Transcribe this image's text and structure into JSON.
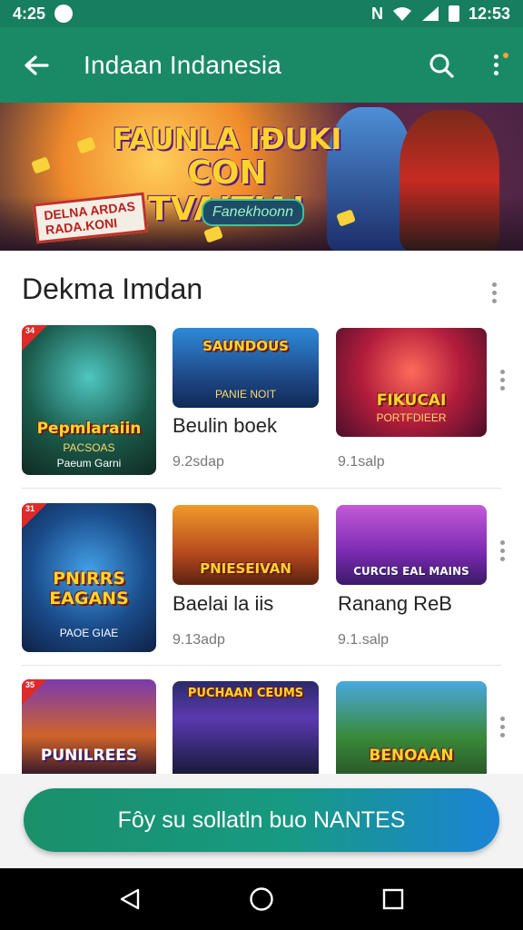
{
  "status_bar": {
    "time": "4:25",
    "right_text": "N",
    "clock": "12:53"
  },
  "app_bar": {
    "title": "Indaan Indanesia"
  },
  "banner": {
    "headline_line1": "FAUNLA IÐUKI",
    "headline_line2": "CON TVAITIA!",
    "sticker_line1": "DELNA ARDAS",
    "sticker_line2": "RADA.KONI",
    "tag": "Fanekhoonn"
  },
  "section": {
    "title": "Dekma Imdan",
    "rows": [
      {
        "featured": {
          "art_title": "Pepmlaraiin",
          "art_sub1": "PACSOAS",
          "art_sub2": "Paeum Garni",
          "corner": "34"
        },
        "items": [
          {
            "art_title": "SAUNDOUS",
            "art_sub": "PANIE NOIT",
            "name": "Beulin boek",
            "size": "9.2sdap"
          },
          {
            "art_title": "FIKUCAI",
            "art_sub": "PORTFDIEER",
            "name": "",
            "size": "9.1salp"
          }
        ]
      },
      {
        "featured": {
          "art_title": "PNIRRS EAGANS",
          "art_sub1": "PAOE GIAE",
          "art_sub2": "",
          "corner": "31"
        },
        "items": [
          {
            "art_title": "PNIESEIVAN",
            "art_sub": "",
            "name": "Baelai la iis",
            "size": "9.13adp"
          },
          {
            "art_title": "CURCIS EAL MAINS",
            "art_sub": "",
            "name": "Ranang ReB",
            "size": "9.1.salp"
          }
        ]
      },
      {
        "featured": {
          "art_title": "PUNILREES",
          "art_sub1": "",
          "art_sub2": "",
          "corner": "35"
        },
        "items": [
          {
            "art_title": "PUCHAAN CEUMS",
            "art_sub": "",
            "name": "",
            "size": ""
          },
          {
            "art_title": "BENOAAN",
            "art_sub": "",
            "name": "",
            "size": ""
          }
        ]
      }
    ]
  },
  "cta": {
    "label": "Fôy su sollatln buo NANTES"
  },
  "colors": {
    "primary": "#1a8a66",
    "status": "#177e60",
    "cta_end": "#1b84d6"
  }
}
